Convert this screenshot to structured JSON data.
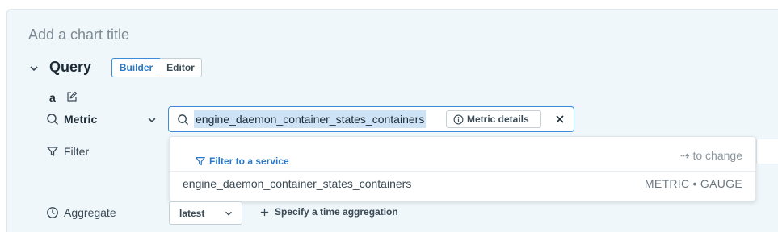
{
  "chart": {
    "title_placeholder": "Add a chart title"
  },
  "query": {
    "label": "Query",
    "modes": {
      "builder": "Builder",
      "editor": "Editor"
    },
    "name": "a"
  },
  "metric": {
    "label": "Metric",
    "value": "engine_daemon_container_states_containers",
    "details_label": "Metric details"
  },
  "filter": {
    "label": "Filter"
  },
  "dropdown": {
    "filter_link": "Filter to a service",
    "hint": "⇢ to change",
    "items": [
      {
        "name": "engine_daemon_container_states_containers",
        "type": "METRIC • GAUGE"
      }
    ]
  },
  "aggregate": {
    "label": "Aggregate",
    "value": "latest",
    "time_aggregation_label": "Specify a time aggregation"
  },
  "colors": {
    "accent": "#2a79c8",
    "panel_bg": "#f0f7fb",
    "highlight": "#cfe3f7"
  }
}
